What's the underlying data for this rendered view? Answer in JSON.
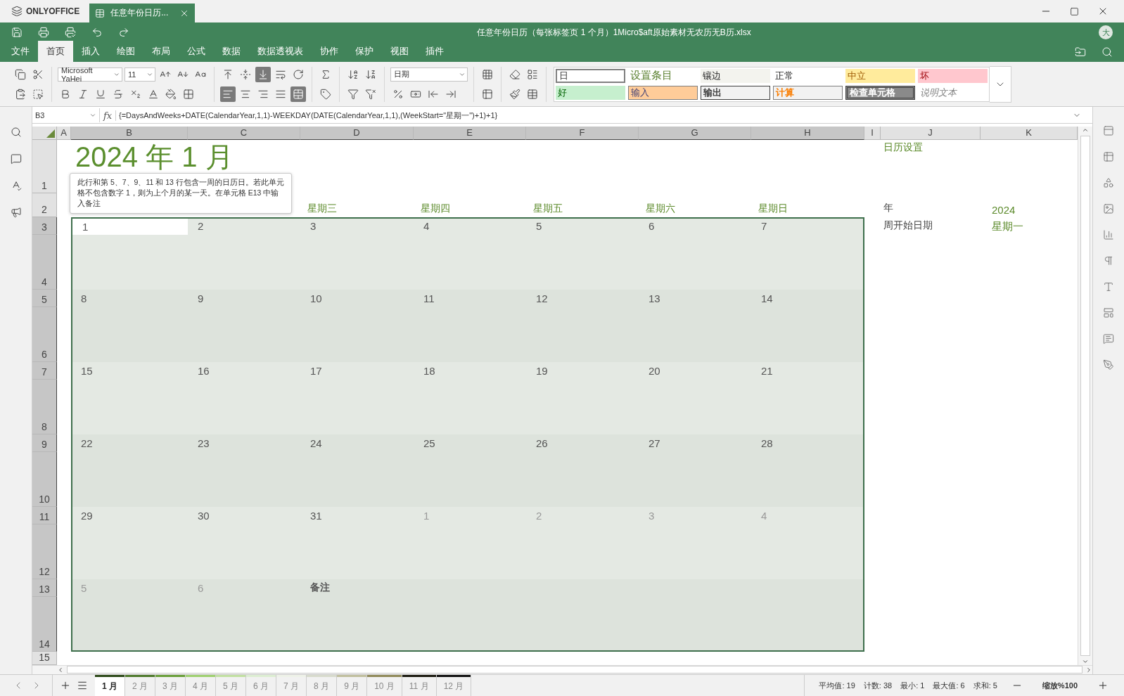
{
  "window": {
    "logo": "ONLYOFFICE",
    "tab_title": "任意年份日历...",
    "file_title": "任意年份日历（每张标签页 1 个月）1Micro$aft原始素材无农历无B历.xlsx",
    "user_initial": "大"
  },
  "menu": [
    {
      "label": "文件",
      "selected": false
    },
    {
      "label": "首页",
      "selected": true
    },
    {
      "label": "插入",
      "selected": false
    },
    {
      "label": "绘图",
      "selected": false
    },
    {
      "label": "布局",
      "selected": false
    },
    {
      "label": "公式",
      "selected": false
    },
    {
      "label": "数据",
      "selected": false
    },
    {
      "label": "数据透视表",
      "selected": false
    },
    {
      "label": "协作",
      "selected": false
    },
    {
      "label": "保护",
      "selected": false
    },
    {
      "label": "视图",
      "selected": false
    },
    {
      "label": "插件",
      "selected": false
    }
  ],
  "toolbar": {
    "font": "Microsoft YaHei",
    "font_size": "11",
    "number_format": "日期",
    "align_bottom": true,
    "align_left": true,
    "merged": true,
    "cell_styles": [
      {
        "label": "日",
        "kind": "selected"
      },
      {
        "label": "设置条目",
        "kind": "heading"
      },
      {
        "label": "镶边",
        "kind": "banded"
      },
      {
        "label": "正常",
        "kind": "normal"
      },
      {
        "label": "中立",
        "kind": "neutral"
      },
      {
        "label": "坏",
        "kind": "bad"
      },
      {
        "label": "好",
        "kind": "good"
      },
      {
        "label": "输入",
        "kind": "input"
      },
      {
        "label": "输出",
        "kind": "output"
      },
      {
        "label": "计算",
        "kind": "calculation"
      },
      {
        "label": "检查单元格",
        "kind": "check"
      },
      {
        "label": "说明文本",
        "kind": "note"
      }
    ]
  },
  "formula_bar": {
    "cell": "B3",
    "function_label": "fx",
    "formula": "{=DaysAndWeeks+DATE(CalendarYear,1,1)-WEEKDAY(DATE(CalendarYear,1,1),(WeekStart=\"星期一\")+1)+1}"
  },
  "sheet": {
    "columns": [
      {
        "label": "A",
        "selected": false
      },
      {
        "label": "B",
        "selected": true
      },
      {
        "label": "C",
        "selected": true
      },
      {
        "label": "D",
        "selected": true
      },
      {
        "label": "E",
        "selected": true
      },
      {
        "label": "F",
        "selected": true
      },
      {
        "label": "G",
        "selected": true
      },
      {
        "label": "H",
        "selected": true
      },
      {
        "label": "I",
        "selected": false
      },
      {
        "label": "J",
        "selected": false
      },
      {
        "label": "K",
        "selected": false
      }
    ],
    "rows": [
      {
        "label": "1",
        "selected": false
      },
      {
        "label": "2",
        "selected": false
      },
      {
        "label": "3",
        "selected": true
      },
      {
        "label": "4",
        "selected": true
      },
      {
        "label": "5",
        "selected": true
      },
      {
        "label": "6",
        "selected": true
      },
      {
        "label": "7",
        "selected": true
      },
      {
        "label": "8",
        "selected": true
      },
      {
        "label": "9",
        "selected": true
      },
      {
        "label": "10",
        "selected": true
      },
      {
        "label": "11",
        "selected": true
      },
      {
        "label": "12",
        "selected": true
      },
      {
        "label": "13",
        "selected": true
      },
      {
        "label": "14",
        "selected": true
      },
      {
        "label": "15",
        "selected": false
      }
    ],
    "title": "2024 年 1 月",
    "tooltip": "此行和第 5、7、9、11 和 13 行包含一周的日历日。若此单元格不包含数字 1，则为上个月的某一天。在单元格 E13 中输入备注",
    "weekday_headers": [
      "星期三",
      "星期四",
      "星期五",
      "星期六",
      "星期日"
    ],
    "weeks": [
      {
        "days": [
          {
            "text": "1",
            "in_month": true,
            "selected": true
          },
          {
            "text": "2",
            "in_month": true,
            "selected": false
          },
          {
            "text": "3",
            "in_month": true,
            "selected": false
          },
          {
            "text": "4",
            "in_month": true,
            "selected": false
          },
          {
            "text": "5",
            "in_month": true,
            "selected": false
          },
          {
            "text": "6",
            "in_month": true,
            "selected": false
          },
          {
            "text": "7",
            "in_month": true,
            "selected": false
          }
        ]
      },
      {
        "days": [
          {
            "text": "8",
            "in_month": true,
            "selected": false
          },
          {
            "text": "9",
            "in_month": true,
            "selected": false
          },
          {
            "text": "10",
            "in_month": true,
            "selected": false
          },
          {
            "text": "11",
            "in_month": true,
            "selected": false
          },
          {
            "text": "12",
            "in_month": true,
            "selected": false
          },
          {
            "text": "13",
            "in_month": true,
            "selected": false
          },
          {
            "text": "14",
            "in_month": true,
            "selected": false
          }
        ]
      },
      {
        "days": [
          {
            "text": "15",
            "in_month": true,
            "selected": false
          },
          {
            "text": "16",
            "in_month": true,
            "selected": false
          },
          {
            "text": "17",
            "in_month": true,
            "selected": false
          },
          {
            "text": "18",
            "in_month": true,
            "selected": false
          },
          {
            "text": "19",
            "in_month": true,
            "selected": false
          },
          {
            "text": "20",
            "in_month": true,
            "selected": false
          },
          {
            "text": "21",
            "in_month": true,
            "selected": false
          }
        ]
      },
      {
        "days": [
          {
            "text": "22",
            "in_month": true,
            "selected": false
          },
          {
            "text": "23",
            "in_month": true,
            "selected": false
          },
          {
            "text": "24",
            "in_month": true,
            "selected": false
          },
          {
            "text": "25",
            "in_month": true,
            "selected": false
          },
          {
            "text": "26",
            "in_month": true,
            "selected": false
          },
          {
            "text": "27",
            "in_month": true,
            "selected": false
          },
          {
            "text": "28",
            "in_month": true,
            "selected": false
          }
        ]
      },
      {
        "days": [
          {
            "text": "29",
            "in_month": true,
            "selected": false
          },
          {
            "text": "30",
            "in_month": true,
            "selected": false
          },
          {
            "text": "31",
            "in_month": true,
            "selected": false
          },
          {
            "text": "1",
            "in_month": false,
            "selected": false
          },
          {
            "text": "2",
            "in_month": false,
            "selected": false
          },
          {
            "text": "3",
            "in_month": false,
            "selected": false
          },
          {
            "text": "4",
            "in_month": false,
            "selected": false
          }
        ]
      },
      {
        "days": [
          {
            "text": "5",
            "in_month": false,
            "selected": false
          },
          {
            "text": "6",
            "in_month": false,
            "selected": false
          }
        ],
        "note": "备注"
      }
    ],
    "settings": {
      "heading": "日历设置",
      "items": [
        {
          "label": "年",
          "value": "2024"
        },
        {
          "label": "周开始日期",
          "value": "星期一"
        }
      ]
    }
  },
  "sheet_tabs": [
    {
      "label": "1 月",
      "color": "#2e4a1a",
      "selected": true
    },
    {
      "label": "2 月",
      "color": "#4f7a2c",
      "selected": false
    },
    {
      "label": "3 月",
      "color": "#6a9f3a",
      "selected": false
    },
    {
      "label": "4 月",
      "color": "#9fd070",
      "selected": false
    },
    {
      "label": "5 月",
      "color": "#c2e0a2",
      "selected": false
    },
    {
      "label": "6 月",
      "color": "#ddeed2",
      "selected": false
    },
    {
      "label": "7 月",
      "color": "#eef2e8",
      "selected": false
    },
    {
      "label": "8 月",
      "color": "#d8dbcd",
      "selected": false
    },
    {
      "label": "9 月",
      "color": "#c1bf9f",
      "selected": false
    },
    {
      "label": "10 月",
      "color": "#908a5a",
      "selected": false
    },
    {
      "label": "11 月",
      "color": "#1b1a10",
      "selected": false
    },
    {
      "label": "12 月",
      "color": "#111111",
      "selected": false
    }
  ],
  "status": {
    "stats": [
      "平均值: 19",
      "计数: 38",
      "最小: 1",
      "最大值: 6",
      "求和: 5"
    ],
    "zoom": "缩放%100"
  }
}
